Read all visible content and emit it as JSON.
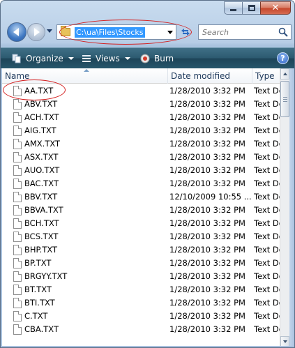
{
  "caption": {
    "minimize": "minimize",
    "maximize": "maximize",
    "close": "✕"
  },
  "address": {
    "path": "C:\\ua\\Files\\Stocks"
  },
  "search": {
    "placeholder": "Search"
  },
  "commands": {
    "organize": "Organize",
    "views": "Views",
    "burn": "Burn",
    "help": "?"
  },
  "columns": {
    "name": "Name",
    "date": "Date modified",
    "type": "Type"
  },
  "files": [
    {
      "name": "AA.TXT",
      "date": "1/28/2010 3:32 PM",
      "type": "Text Document"
    },
    {
      "name": "ABV.TXT",
      "date": "1/28/2010 3:32 PM",
      "type": "Text Document"
    },
    {
      "name": "ACH.TXT",
      "date": "1/28/2010 3:32 PM",
      "type": "Text Document"
    },
    {
      "name": "AIG.TXT",
      "date": "1/28/2010 3:32 PM",
      "type": "Text Document"
    },
    {
      "name": "AMX.TXT",
      "date": "1/28/2010 3:32 PM",
      "type": "Text Document"
    },
    {
      "name": "ASX.TXT",
      "date": "1/28/2010 3:32 PM",
      "type": "Text Document"
    },
    {
      "name": "AUO.TXT",
      "date": "1/28/2010 3:32 PM",
      "type": "Text Document"
    },
    {
      "name": "BAC.TXT",
      "date": "1/28/2010 3:32 PM",
      "type": "Text Document"
    },
    {
      "name": "BBV.TXT",
      "date": "12/10/2009 10:55 ...",
      "type": "Text Document"
    },
    {
      "name": "BBVA.TXT",
      "date": "1/28/2010 3:32 PM",
      "type": "Text Document"
    },
    {
      "name": "BCH.TXT",
      "date": "1/28/2010 3:32 PM",
      "type": "Text Document"
    },
    {
      "name": "BCS.TXT",
      "date": "1/28/2010 3:32 PM",
      "type": "Text Document"
    },
    {
      "name": "BHP.TXT",
      "date": "1/28/2010 3:32 PM",
      "type": "Text Document"
    },
    {
      "name": "BP.TXT",
      "date": "1/28/2010 3:32 PM",
      "type": "Text Document"
    },
    {
      "name": "BRGYY.TXT",
      "date": "1/28/2010 3:32 PM",
      "type": "Text Document"
    },
    {
      "name": "BT.TXT",
      "date": "1/28/2010 3:32 PM",
      "type": "Text Document"
    },
    {
      "name": "BTI.TXT",
      "date": "1/28/2010 3:32 PM",
      "type": "Text Document"
    },
    {
      "name": "C.TXT",
      "date": "1/28/2010 3:32 PM",
      "type": "Text Document"
    },
    {
      "name": "CBA.TXT",
      "date": "1/28/2010 3:32 PM",
      "type": "Text Document"
    }
  ]
}
